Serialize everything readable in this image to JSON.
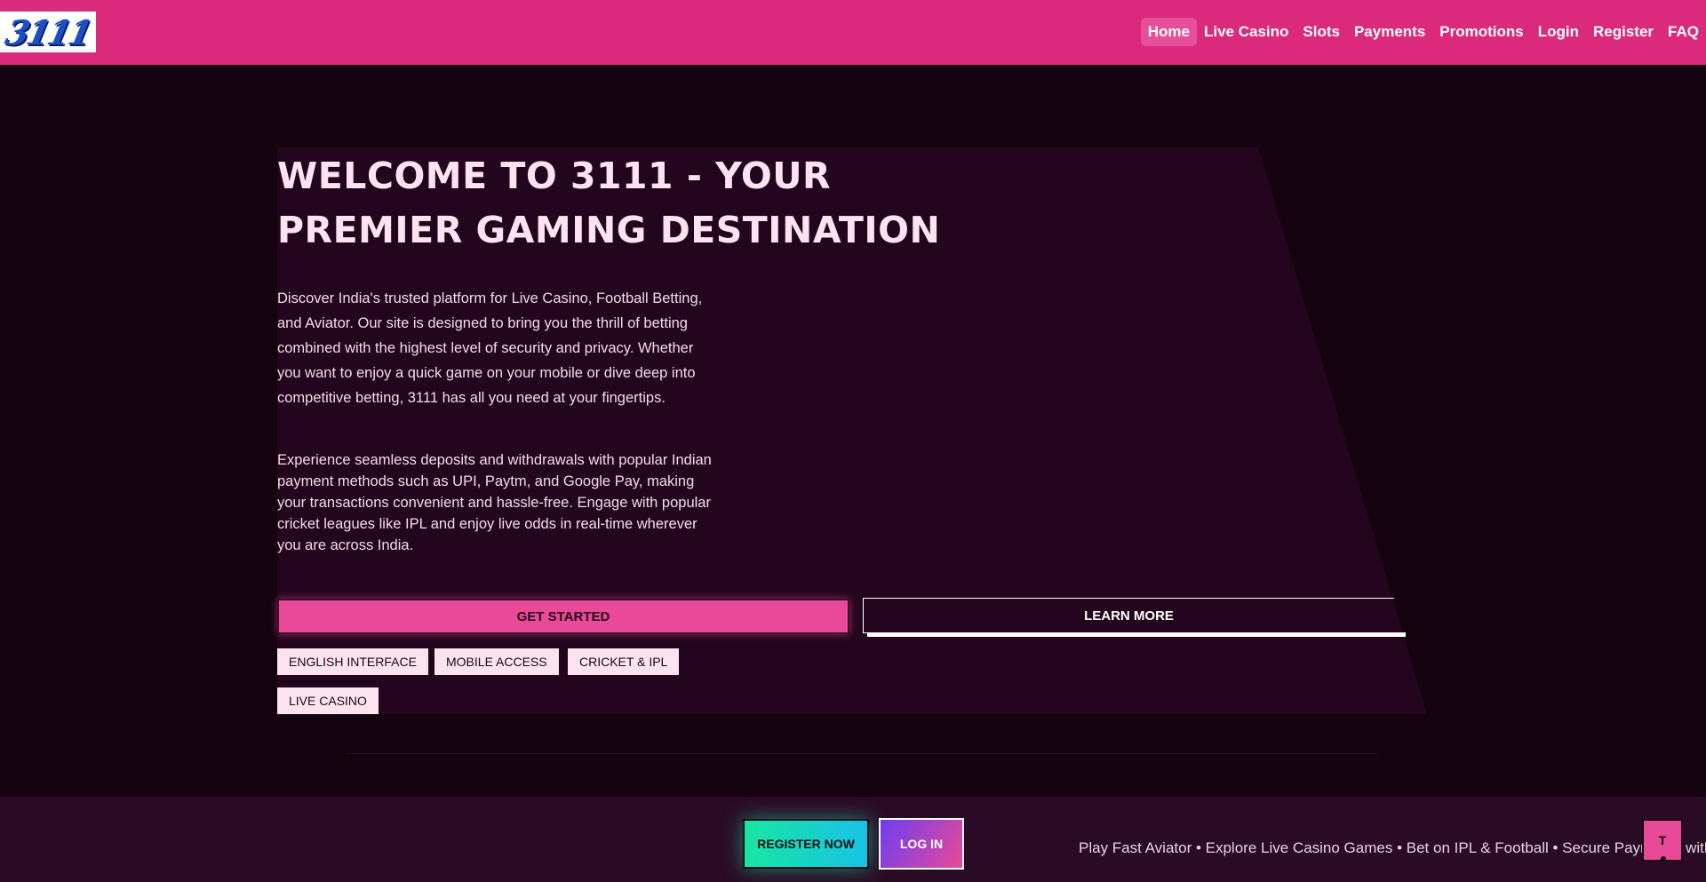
{
  "header": {
    "logo_text": "3111",
    "nav": [
      "Home",
      "Live Casino",
      "Slots",
      "Payments",
      "Promotions",
      "Login",
      "Register",
      "FAQ"
    ],
    "active_nav": "Home",
    "accent_color": "#db2a7c"
  },
  "hero": {
    "title": "WELCOME TO 3111 - YOUR PREMIER GAMING DESTINATION",
    "paragraph_1": "Discover India's trusted platform for Live Casino, Football Betting, and Aviator. Our site is designed to bring you the thrill of betting combined with the highest level of security and privacy. Whether you want to enjoy a quick game on your mobile or dive deep into competitive betting, 3111 has all you need at your fingertips.",
    "paragraph_2": "Experience seamless deposits and withdrawals with popular Indian payment methods such as UPI, Paytm, and Google Pay, making your transactions convenient and hassle-free. Engage with popular cricket leagues like IPL and enjoy live odds in real-time wherever you are across India.",
    "get_started_label": "GET STARTED",
    "learn_more_label": "LEARN MORE",
    "tags": [
      "ENGLISH INTERFACE",
      "MOBILE ACCESS",
      "CRICKET & IPL",
      "LIVE CASINO"
    ]
  },
  "footer": {
    "register_label": "REGISTER NOW",
    "login_label": "LOG IN",
    "ticker_text": "Play Fast Aviator • Explore Live Casino Games • Bet on IPL & Football • Secure Payments with",
    "fab_label": "T",
    "fab_icon": "scroll-top-icon"
  }
}
